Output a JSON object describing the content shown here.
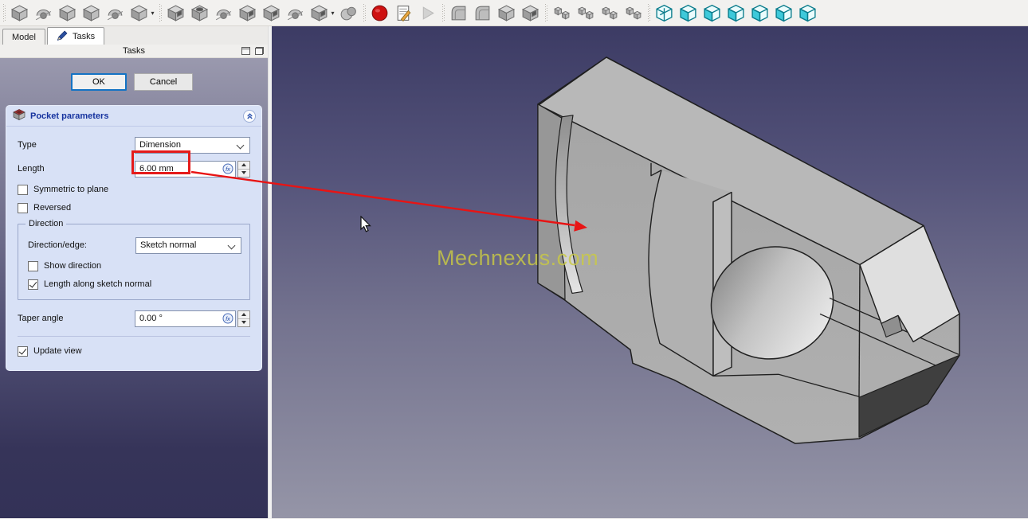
{
  "toolbar": {
    "groups": [
      {
        "icons": [
          {
            "name": "pad-icon",
            "type": "cube"
          },
          {
            "name": "revolution-icon",
            "type": "rev"
          },
          {
            "name": "additive-loft-icon",
            "type": "cube"
          },
          {
            "name": "additive-pipe-icon",
            "type": "cube"
          },
          {
            "name": "additive-helix-icon",
            "type": "rev"
          },
          {
            "name": "additive-primitive-icon",
            "type": "cube",
            "dropdown": true
          }
        ]
      },
      {
        "icons": [
          {
            "name": "pocket-icon",
            "type": "cubehole"
          },
          {
            "name": "hole-icon",
            "type": "cuberound"
          },
          {
            "name": "groove-icon",
            "type": "rev"
          },
          {
            "name": "subtractive-loft-icon",
            "type": "cubehole"
          },
          {
            "name": "subtractive-pipe-icon",
            "type": "cubehole"
          },
          {
            "name": "subtractive-helix-icon",
            "type": "rev"
          },
          {
            "name": "subtractive-primitive-icon",
            "type": "cubehole",
            "dropdown": true
          },
          {
            "name": "boolean-operation-icon",
            "type": "spheres"
          }
        ]
      },
      {
        "icons": [
          {
            "name": "record-macro-icon",
            "type": "record"
          },
          {
            "name": "macros-dialog-icon",
            "type": "doc"
          },
          {
            "name": "execute-macro-icon",
            "type": "play",
            "disabled": true
          }
        ]
      },
      {
        "icons": [
          {
            "name": "fillet-icon",
            "type": "fillet"
          },
          {
            "name": "chamfer-icon",
            "type": "fillet"
          },
          {
            "name": "draft-icon",
            "type": "cube"
          },
          {
            "name": "thickness-icon",
            "type": "cubehole"
          }
        ]
      },
      {
        "icons": [
          {
            "name": "mirrored-icon",
            "type": "pattern"
          },
          {
            "name": "linear-pattern-icon",
            "type": "pattern"
          },
          {
            "name": "polar-pattern-icon",
            "type": "pattern"
          },
          {
            "name": "multitransform-icon",
            "type": "pattern"
          }
        ]
      },
      {
        "icons": [
          {
            "name": "axonometric-view-icon",
            "type": "vcaxo"
          },
          {
            "name": "front-view-icon",
            "type": "vc"
          },
          {
            "name": "top-view-icon",
            "type": "vc"
          },
          {
            "name": "right-view-icon",
            "type": "vc"
          },
          {
            "name": "rear-view-icon",
            "type": "vc"
          },
          {
            "name": "bottom-view-icon",
            "type": "vc"
          },
          {
            "name": "left-view-icon",
            "type": "vc"
          }
        ]
      }
    ],
    "dropdown_glyph": "▾"
  },
  "tabs": {
    "model": "Model",
    "tasks": "Tasks"
  },
  "dock": {
    "title": "Tasks"
  },
  "actions": {
    "ok": "OK",
    "cancel": "Cancel"
  },
  "panel": {
    "title": "Pocket parameters",
    "type_label": "Type",
    "type_value": "Dimension",
    "length_label": "Length",
    "length_value": "6.00 mm",
    "symmetric_label": "Symmetric to plane",
    "reversed_label": "Reversed",
    "direction_group_label": "Direction",
    "direction_edge_label": "Direction/edge:",
    "direction_edge_value": "Sketch normal",
    "show_direction_label": "Show direction",
    "length_along_label": "Length along sketch normal",
    "taper_label": "Taper angle",
    "taper_value": "0.00 °",
    "update_view_label": "Update view",
    "checks": {
      "symmetric": false,
      "reversed": false,
      "show_direction": false,
      "length_along": true,
      "update_view": true
    },
    "expression_glyph": "fx"
  },
  "viewport": {
    "watermark": "Mechnexus.com"
  },
  "colors": {
    "highlight_red": "#e51b1b",
    "header_blue": "#16339f",
    "ok_focus_blue": "#1473c4",
    "viewcube_teal": "#0a7c8c",
    "viewport_top": "#3c3b64",
    "viewport_bottom": "#9595a7",
    "panel_bg": "#d8e1f6"
  }
}
